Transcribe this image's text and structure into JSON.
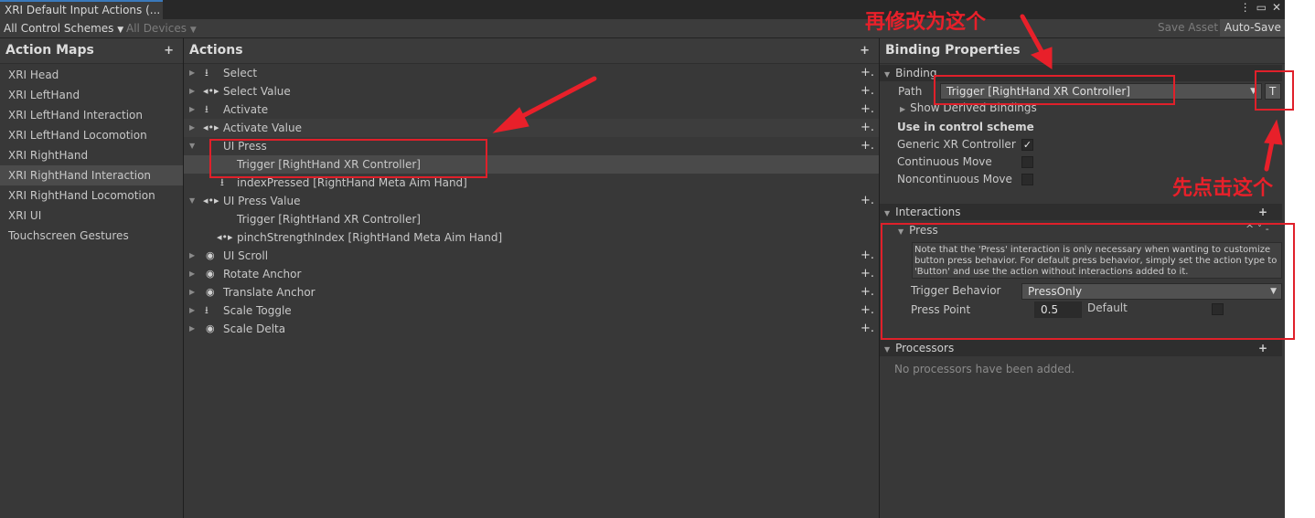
{
  "window": {
    "tab_title": "XRI Default Input Actions (...",
    "toolbar": {
      "control_schemes": "All Control Schemes",
      "devices": "All Devices",
      "save_asset": "Save Asset",
      "auto_save": "Auto-Save"
    }
  },
  "action_maps": {
    "title": "Action Maps",
    "add": "+",
    "items": [
      "XRI Head",
      "XRI LeftHand",
      "XRI LeftHand Interaction",
      "XRI LeftHand Locomotion",
      "XRI RightHand",
      "XRI RightHand Interaction",
      "XRI RightHand Locomotion",
      "XRI UI",
      "Touchscreen Gestures"
    ],
    "selected": "XRI RightHand Interaction"
  },
  "actions": {
    "title": "Actions",
    "add": "+",
    "add_binding": "+.",
    "rows": [
      {
        "label": "Select",
        "icon": "button-action-icon",
        "expanded": false
      },
      {
        "label": "Select Value",
        "icon": "value-action-icon",
        "expanded": false
      },
      {
        "label": "Activate",
        "icon": "button-action-icon",
        "expanded": false
      },
      {
        "label": "Activate Value",
        "icon": "value-action-icon",
        "expanded": false
      },
      {
        "label": "UI Press",
        "icon": "none",
        "expanded": true
      },
      {
        "label": "Trigger [RightHand XR Controller]",
        "binding": true,
        "selected": true
      },
      {
        "label": "indexPressed [RightHand Meta Aim Hand]",
        "binding": true
      },
      {
        "label": "UI Press Value",
        "icon": "value-action-icon",
        "expanded": true
      },
      {
        "label": "Trigger [RightHand XR Controller]",
        "binding": true
      },
      {
        "label": "pinchStrengthIndex [RightHand Meta Aim Hand]",
        "binding": true
      },
      {
        "label": "UI Scroll",
        "icon": "passthrough-action-icon",
        "expanded": false
      },
      {
        "label": "Rotate Anchor",
        "icon": "passthrough-action-icon",
        "expanded": false
      },
      {
        "label": "Translate Anchor",
        "icon": "passthrough-action-icon",
        "expanded": false
      },
      {
        "label": "Scale Toggle",
        "icon": "button-action-icon",
        "expanded": false
      },
      {
        "label": "Scale Delta",
        "icon": "passthrough-action-icon",
        "expanded": false
      }
    ]
  },
  "binding_properties": {
    "title": "Binding Properties",
    "binding_section": "Binding",
    "path_label": "Path",
    "path_value": "Trigger [RightHand XR Controller]",
    "t_button": "T",
    "show_derived": "Show Derived Bindings",
    "use_in_scheme": "Use in control scheme",
    "schemes": [
      {
        "name": "Generic XR Controller",
        "checked": true
      },
      {
        "name": "Continuous Move",
        "checked": false
      },
      {
        "name": "Noncontinuous Move",
        "checked": false
      }
    ],
    "interactions_section": "Interactions",
    "interactions_add": "+",
    "press_title": "Press",
    "press_controls": "^ ˅ -",
    "note": "Note that the 'Press' interaction is only necessary when wanting to customize button press behavior. For default press behavior, simply set the action type to 'Button' and use the action without interactions added to it.",
    "trigger_behavior_label": "Trigger Behavior",
    "trigger_behavior_value": "PressOnly",
    "press_point_label": "Press Point",
    "press_point_value": "0.5",
    "default_label": "Default",
    "processors_section": "Processors",
    "processors_add": "+",
    "no_processors": "No processors have been added."
  },
  "annotations": {
    "modify": "再修改为这个",
    "click_first": "先点击这个",
    "color": "#e8202a"
  }
}
